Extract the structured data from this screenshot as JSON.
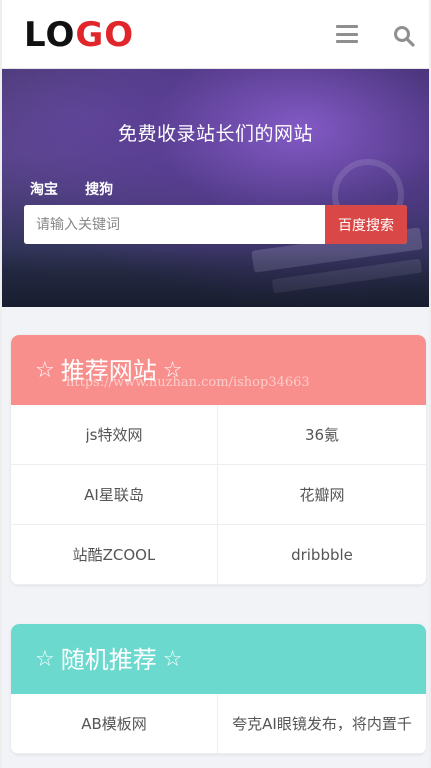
{
  "header": {
    "logo_part1": "LO",
    "logo_part2": "GO",
    "menu_icon": "hamburger-menu-icon",
    "search_icon": "search-icon"
  },
  "hero": {
    "title": "免费收录站长们的网站",
    "engines": [
      "淘宝",
      "搜狗"
    ],
    "search_placeholder": "请输入关键词",
    "search_button": "百度搜索"
  },
  "sections": [
    {
      "title": "推荐网站",
      "watermark": "https://www.huzhan.com/ishop34663",
      "color": "#f98f8c",
      "items": [
        "js特效网",
        "36氪",
        "AI星联岛",
        "花瓣网",
        "站酷ZCOOL",
        "dribbble"
      ]
    },
    {
      "title": "随机推荐",
      "color": "#6cd9cf",
      "items": [
        "AB模板网",
        "夸克AI眼镜发布，将内置千"
      ]
    }
  ],
  "colors": {
    "accent_red": "#d94847",
    "logo_red": "#e0262b",
    "recommend_header": "#f98f8c",
    "random_header": "#6cd9cf"
  }
}
